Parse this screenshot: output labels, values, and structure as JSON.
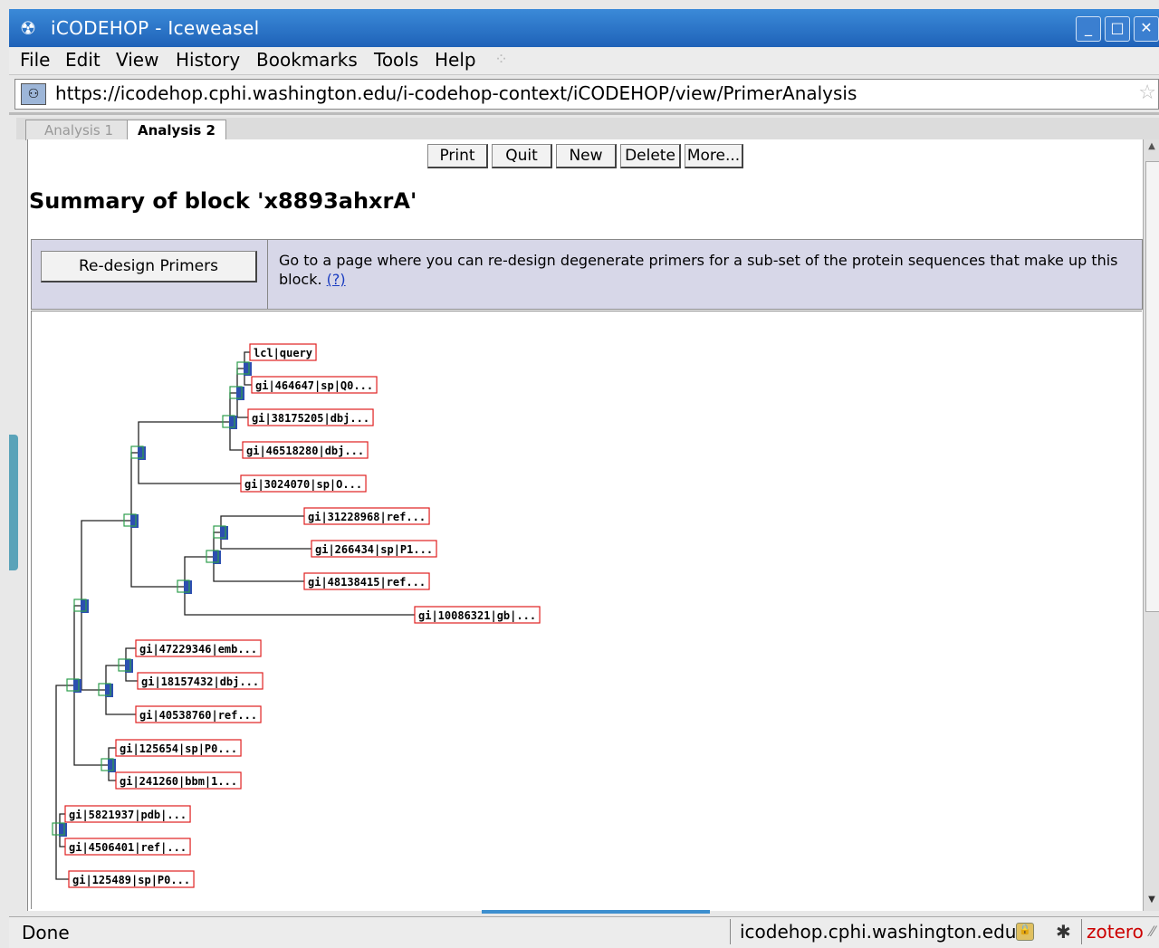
{
  "window": {
    "title": "iCODEHOP - Iceweasel",
    "buttons": [
      "_",
      "□",
      "✕"
    ]
  },
  "menu": [
    "File",
    "Edit",
    "View",
    "History",
    "Bookmarks",
    "Tools",
    "Help"
  ],
  "address": {
    "url": "https://icodehop.cphi.washington.edu/i-codehop-context/iCODEHOP/view/PrimerAnalysis"
  },
  "tabs": [
    "Analysis 1",
    "Analysis 2"
  ],
  "toolbar": {
    "print": "Print",
    "quit": "Quit",
    "new": "New",
    "delete": "Delete",
    "more": "More..."
  },
  "page_title": "Summary of block 'x8893ahxrA'",
  "redesign": {
    "button_label": "Re-design Primers",
    "description": "Go to a page where you can re-design degenerate primers for a sub-set of the protein sequences that make up this block.",
    "help_link": "(?)"
  },
  "tree": {
    "leaves": [
      "lcl|query",
      "gi|464647|sp|Q0...",
      "gi|38175205|dbj...",
      "gi|46518280|dbj...",
      "gi|3024070|sp|O...",
      "gi|31228968|ref...",
      "gi|266434|sp|P1...",
      "gi|48138415|ref...",
      "gi|10086321|gb|...",
      "gi|47229346|emb...",
      "gi|18157432|dbj...",
      "gi|40538760|ref...",
      "gi|125654|sp|P0...",
      "gi|241260|bbm|1...",
      "gi|5821937|pdb|...",
      "gi|4506401|ref|...",
      "gi|125489|sp|P0..."
    ]
  },
  "status": {
    "text": "Done",
    "host": "icodehop.cphi.washington.edu",
    "zotero": "zotero"
  }
}
